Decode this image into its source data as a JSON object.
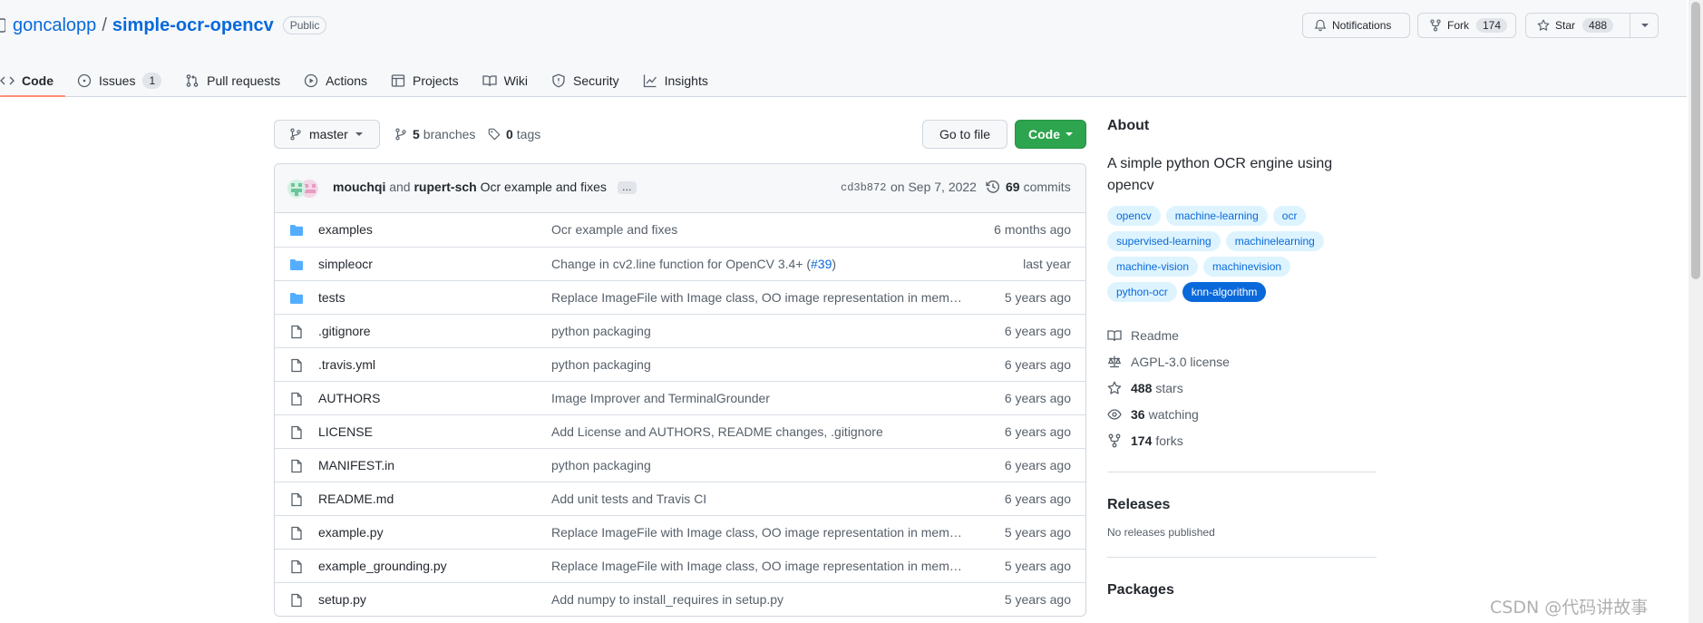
{
  "repo": {
    "owner": "goncalopp",
    "separator": "/",
    "name": "simple-ocr-opencv",
    "visibility": "Public"
  },
  "header_actions": {
    "notifications": "Notifications",
    "fork": "Fork",
    "fork_count": "174",
    "star": "Star",
    "star_count": "488"
  },
  "tabs": [
    {
      "label": "Code",
      "icon": "code-icon",
      "selected": true
    },
    {
      "label": "Issues",
      "icon": "issue-icon",
      "count": "1"
    },
    {
      "label": "Pull requests",
      "icon": "pull-request-icon"
    },
    {
      "label": "Actions",
      "icon": "play-icon"
    },
    {
      "label": "Projects",
      "icon": "table-icon"
    },
    {
      "label": "Wiki",
      "icon": "book-icon"
    },
    {
      "label": "Security",
      "icon": "shield-icon"
    },
    {
      "label": "Insights",
      "icon": "graph-icon"
    }
  ],
  "branch": {
    "current": "master",
    "branches_count": "5",
    "branches_label": "branches",
    "tags_count": "0",
    "tags_label": "tags",
    "go_to_file": "Go to file",
    "code_button": "Code"
  },
  "latest_commit": {
    "author1": "mouchqi",
    "and": "and",
    "author2": "rupert-sch",
    "message": "Ocr example and fixes",
    "ellipsis": "…",
    "hash": "cd3b872",
    "date": "on Sep 7, 2022",
    "commits_count": "69",
    "commits_label": "commits"
  },
  "files": [
    {
      "type": "dir",
      "name": "examples",
      "message": "Ocr example and fixes",
      "age": "6 months ago"
    },
    {
      "type": "dir",
      "name": "simpleocr",
      "message": "Change in cv2.line function for OpenCV 3.4+ (",
      "link": "#39",
      "message_end": ")",
      "age": "last year"
    },
    {
      "type": "dir",
      "name": "tests",
      "message": "Replace ImageFile with Image class, OO image representation in memor…",
      "age": "5 years ago"
    },
    {
      "type": "file",
      "name": ".gitignore",
      "message": "python packaging",
      "age": "6 years ago"
    },
    {
      "type": "file",
      "name": ".travis.yml",
      "message": "python packaging",
      "age": "6 years ago"
    },
    {
      "type": "file",
      "name": "AUTHORS",
      "message": "Image Improver and TerminalGrounder",
      "age": "6 years ago"
    },
    {
      "type": "file",
      "name": "LICENSE",
      "message": "Add License and AUTHORS, README changes, .gitignore",
      "age": "6 years ago"
    },
    {
      "type": "file",
      "name": "MANIFEST.in",
      "message": "python packaging",
      "age": "6 years ago"
    },
    {
      "type": "file",
      "name": "README.md",
      "message": "Add unit tests and Travis CI",
      "age": "6 years ago"
    },
    {
      "type": "file",
      "name": "example.py",
      "message": "Replace ImageFile with Image class, OO image representation in memor…",
      "age": "5 years ago"
    },
    {
      "type": "file",
      "name": "example_grounding.py",
      "message": "Replace ImageFile with Image class, OO image representation in memor…",
      "age": "5 years ago"
    },
    {
      "type": "file",
      "name": "setup.py",
      "message": "Add numpy to install_requires in setup.py",
      "age": "5 years ago"
    }
  ],
  "about": {
    "title": "About",
    "description": "A simple python OCR engine using opencv",
    "topics": [
      {
        "label": "opencv"
      },
      {
        "label": "machine-learning"
      },
      {
        "label": "ocr"
      },
      {
        "label": "supervised-learning"
      },
      {
        "label": "machinelearning"
      },
      {
        "label": "machine-vision"
      },
      {
        "label": "machinevision"
      },
      {
        "label": "python-ocr"
      },
      {
        "label": "knn-algorithm",
        "active": true
      }
    ],
    "readme": "Readme",
    "license": "AGPL-3.0 license",
    "stars_count": "488",
    "stars_label": "stars",
    "watching_count": "36",
    "watching_label": "watching",
    "forks_count": "174",
    "forks_label": "forks"
  },
  "releases": {
    "title": "Releases",
    "empty": "No releases published"
  },
  "packages": {
    "title": "Packages"
  },
  "watermark": "CSDN @代码讲故事",
  "colors": {
    "link": "#0969da",
    "primary_button": "#2da44e",
    "tab_underline": "#fd8c73",
    "folder": "#54aeff"
  }
}
